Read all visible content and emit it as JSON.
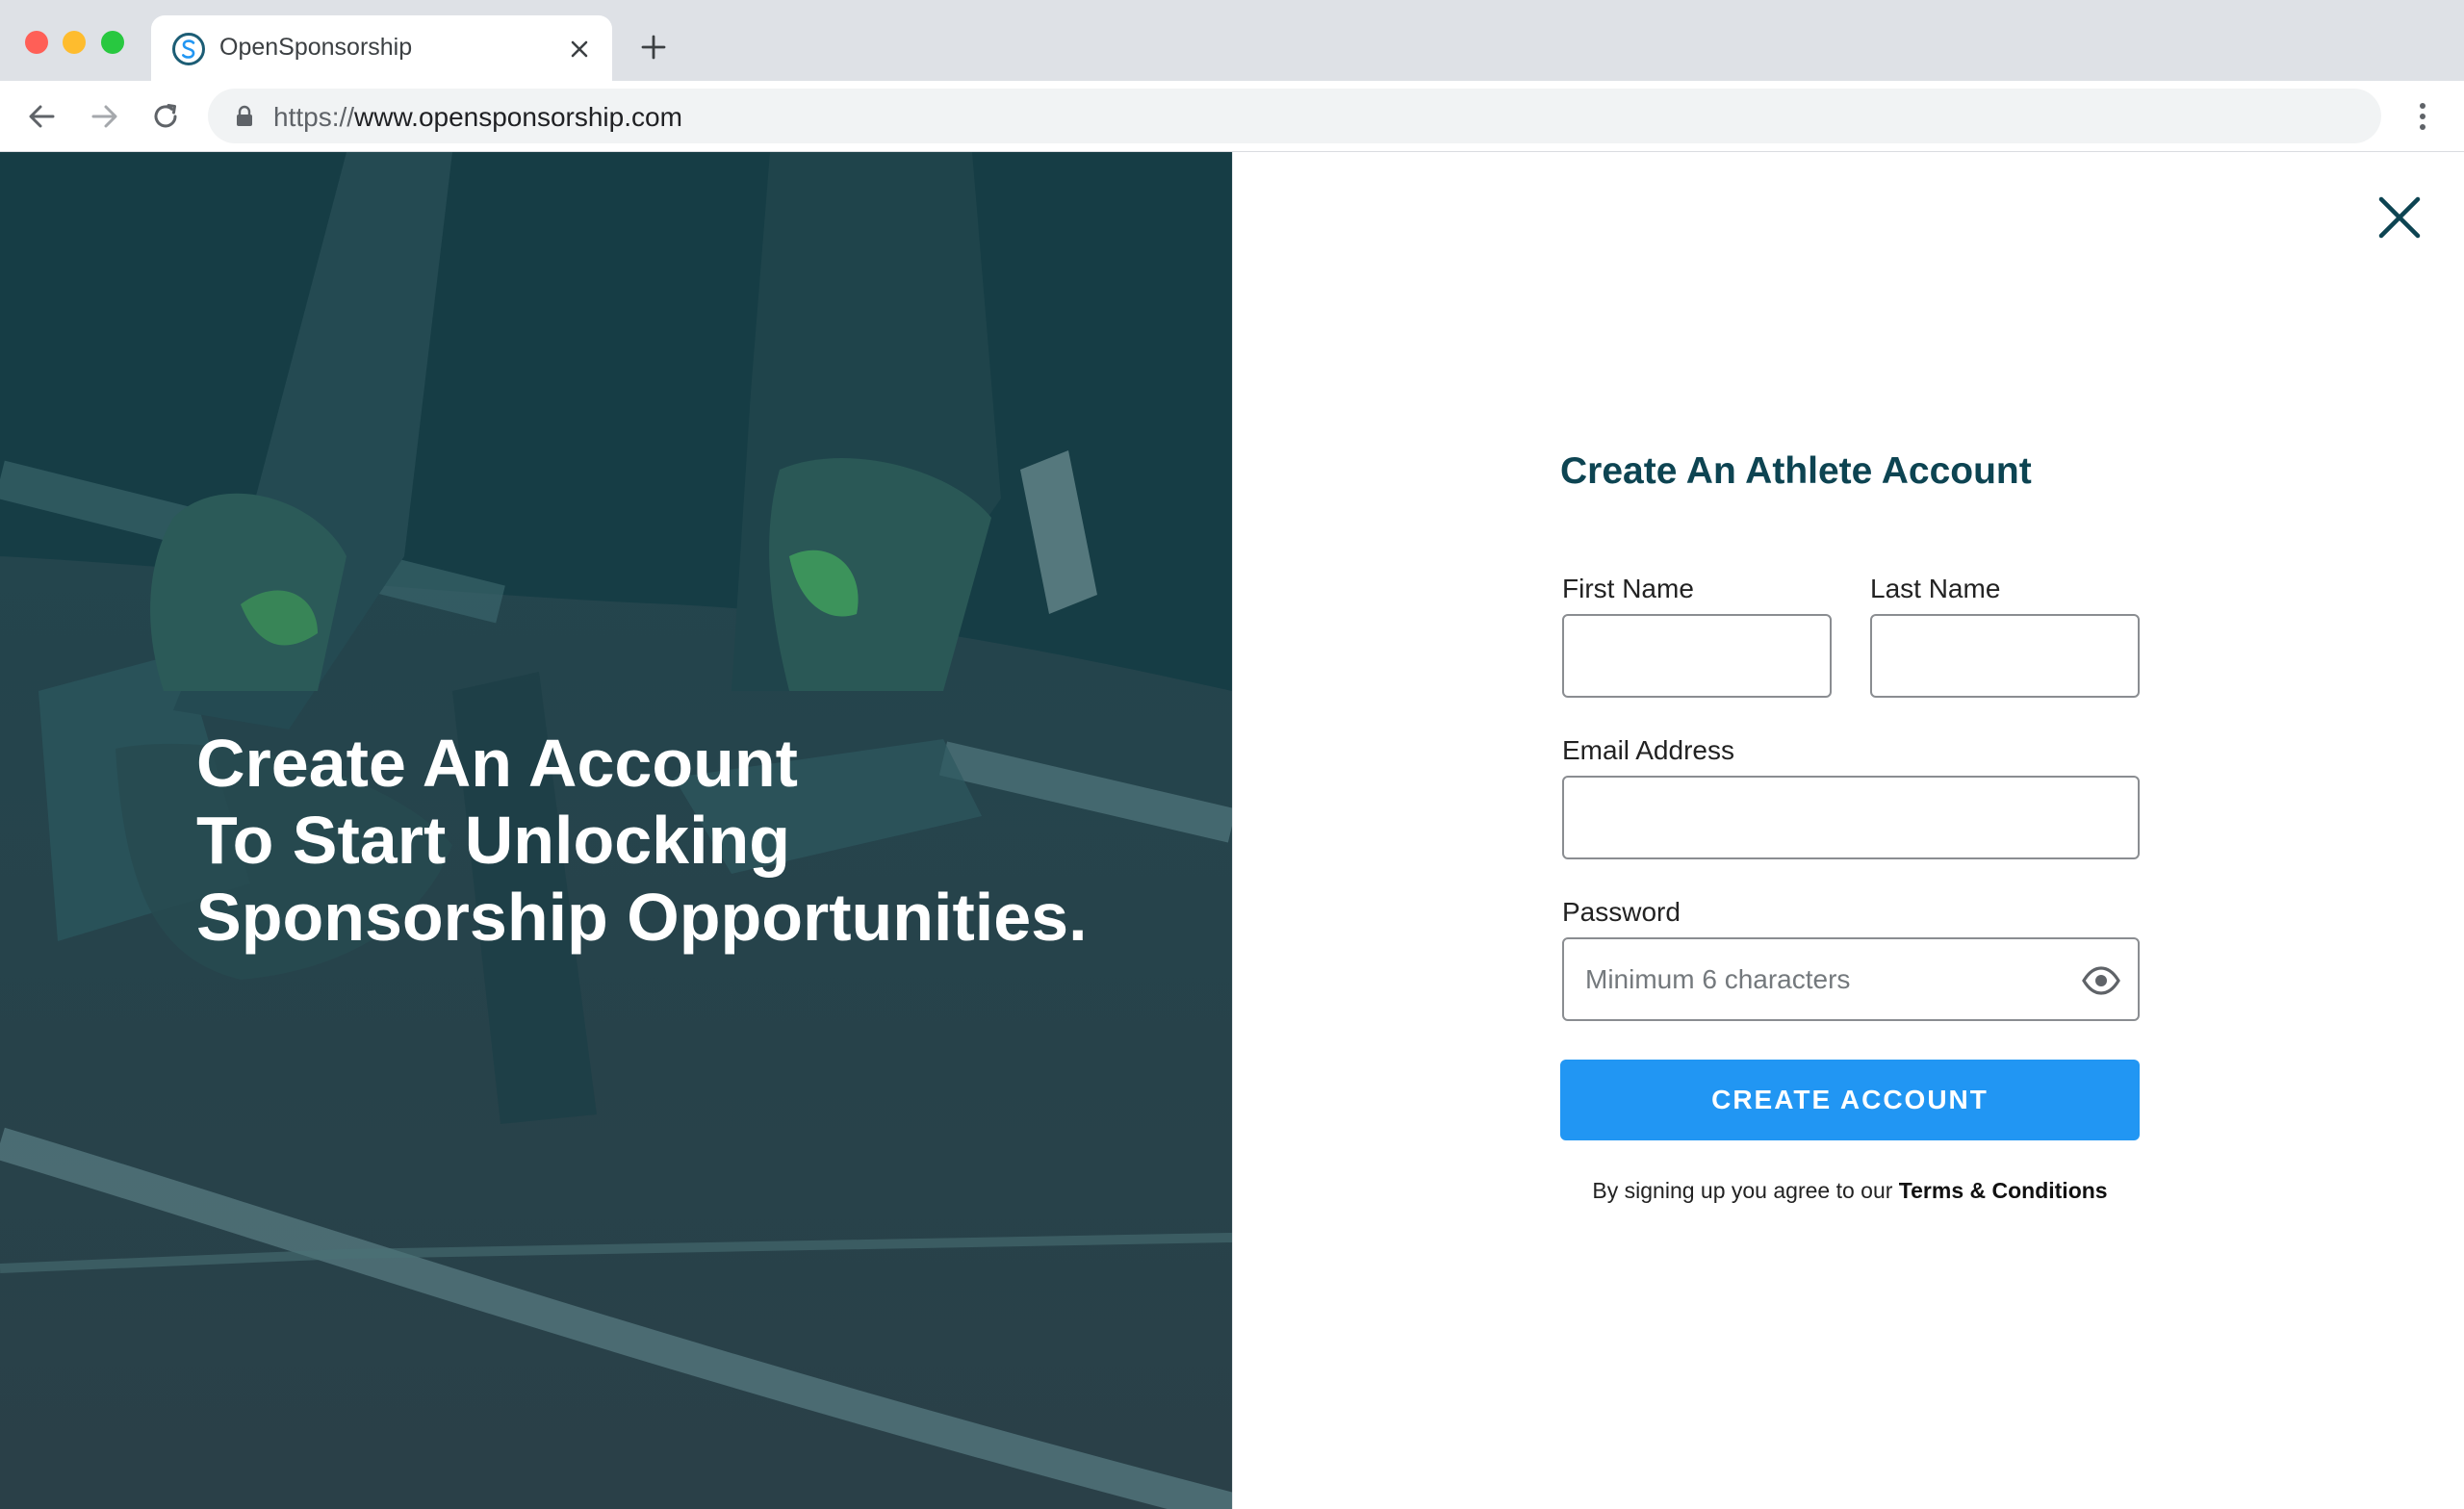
{
  "browser": {
    "tab": {
      "title": "OpenSponsorship",
      "favicon": "opensponsorship-logo-icon"
    },
    "url": {
      "scheme": "https://",
      "host": "www.opensponsorship.com"
    },
    "icons": [
      "close-icon",
      "plus-icon",
      "back-arrow-icon",
      "forward-arrow-icon",
      "reload-icon",
      "lock-icon",
      "kebab-menu-icon"
    ]
  },
  "hero": {
    "heading_lines": [
      "Create An Account",
      "To Start Unlocking",
      "Sponsorship Opportunities."
    ],
    "overlay_color": "#1b4a52"
  },
  "form": {
    "title": "Create An Athlete Account",
    "first_name": {
      "label": "First Name",
      "value": ""
    },
    "last_name": {
      "label": "Last Name",
      "value": ""
    },
    "email": {
      "label": "Email Address",
      "value": ""
    },
    "password": {
      "label": "Password",
      "value": "",
      "placeholder": "Minimum 6 characters",
      "toggle_icon": "eye-icon"
    },
    "submit_label": "CREATE ACCOUNT",
    "terms_prefix": "By signing up you agree to our",
    "terms_link": "Terms & Conditions"
  },
  "colors": {
    "title": "#0d4452",
    "button": "#2196f3",
    "close": "#0d4452"
  }
}
